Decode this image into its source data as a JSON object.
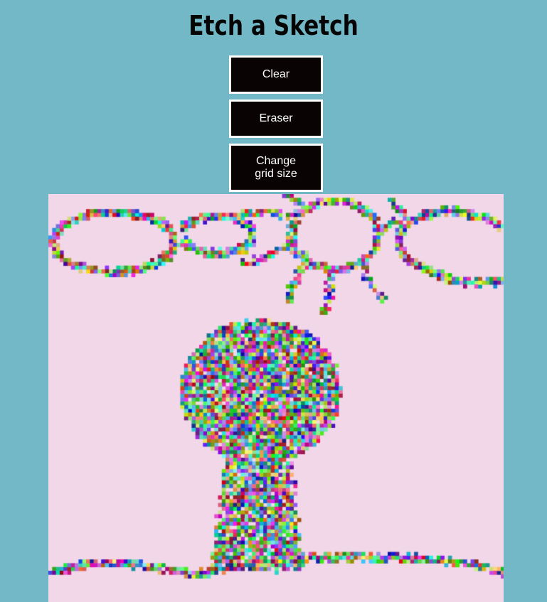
{
  "app": {
    "title": "Etch a Sketch"
  },
  "controls": {
    "clear_label": "Clear",
    "eraser_label": "Eraser",
    "grid_size_label": "Change\ngrid size"
  },
  "colors": {
    "page_background": "#72b8c7",
    "button_background": "#090304",
    "button_border": "#ffffff",
    "button_text": "#ffffff",
    "canvas_background": "#f1d7e8"
  }
}
